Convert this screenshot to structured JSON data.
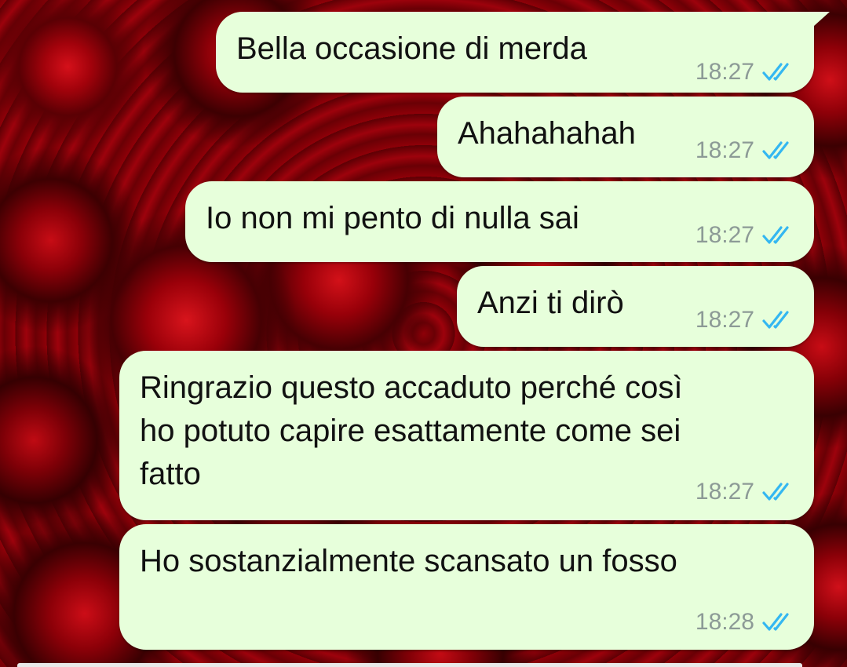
{
  "messages": [
    {
      "text": "Bella occasione di merda",
      "time": "18:27",
      "status": "read"
    },
    {
      "text": "Ahahahahah",
      "time": "18:27",
      "status": "read"
    },
    {
      "text": "Io non mi pento di nulla sai",
      "time": "18:27",
      "status": "read"
    },
    {
      "text": "Anzi ti dirò",
      "time": "18:27",
      "status": "read"
    },
    {
      "text": "Ringrazio questo accaduto perché così\nho potuto capire esattamente come sei\nfatto",
      "time": "18:27",
      "status": "read"
    },
    {
      "text": "Ho sostanzialmente scansato un fosso",
      "time": "18:28",
      "status": "read"
    }
  ],
  "colors": {
    "bubble_outgoing": "#e7ffdb",
    "read_ticks": "#34b7f1",
    "timestamp": "#8c9a96",
    "wallpaper": "#b0000b"
  },
  "icons": {
    "wallpaper": "red-roses",
    "status": "double-check-icon"
  }
}
